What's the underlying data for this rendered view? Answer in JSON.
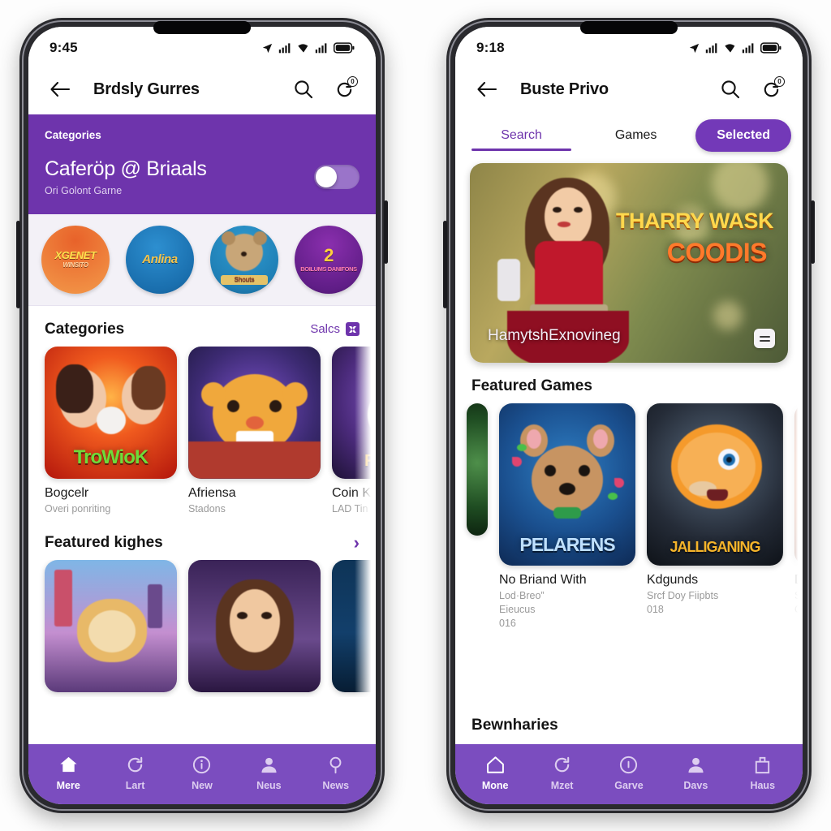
{
  "theme": {
    "brand_purple": "#6E34AC",
    "nav_purple": "#7B4DBF",
    "pill_purple": "#7339B8",
    "muted_text": "#9A9A9A"
  },
  "left_phone": {
    "status": {
      "time": "9:45"
    },
    "appbar": {
      "title": "Brdsly Gurres",
      "back_icon": "arrow-left-icon",
      "search_icon": "search-icon",
      "sync_icon": "refresh-icon",
      "sync_badge": "0"
    },
    "promo": {
      "kicker": "Categories",
      "title": "Caferöp @ Briaals",
      "subtitle": "Ori Golont Garne",
      "toggle_state": "off"
    },
    "circles": [
      {
        "label": "XGENET",
        "sub": "WINSITO",
        "bg": "#e8622a",
        "bg2": "#f39a4a",
        "text": "#ffe14d"
      },
      {
        "label": "Anlina",
        "sub": "",
        "bg": "#1a6fae",
        "bg2": "#2d8fd0",
        "text": "#f7c44a"
      },
      {
        "label": "Shouts",
        "sub": "",
        "bg": "#1f7fb5",
        "bg2": "#2f9ad0",
        "text": "#ffffff"
      },
      {
        "label": "2",
        "sub": "BOILUMS DANIFONS",
        "bg": "#5f1d86",
        "bg2": "#8a2fae",
        "text": "#ffcf3d"
      }
    ],
    "categories_section": {
      "title": "Categories",
      "action_label": "Salcs",
      "action_icon": "shuffle-icon"
    },
    "category_cards": [
      {
        "art_text": "TroWioK",
        "name": "Bogcelr",
        "sub": "Overi ponriting",
        "art_class": "art-trowiok"
      },
      {
        "art_text": "",
        "name": "Afriensa",
        "sub": "Stadons",
        "art_class": "art-afriensa"
      },
      {
        "art_text": "FAC VAW",
        "name": "Coin K",
        "sub": "LAD Tin",
        "art_class": "art-coink"
      }
    ],
    "featured_section": {
      "title": "Featured kighes",
      "action_icon": "chevron-right-icon"
    },
    "featured_cards": [
      {
        "art_class": "art-city",
        "name": "",
        "sub": ""
      },
      {
        "art_class": "art-girl",
        "name": "",
        "sub": ""
      },
      {
        "art_class": "art-apple",
        "name": "",
        "sub": ""
      }
    ],
    "bottom_nav": [
      {
        "label": "Mere",
        "icon": "home-icon",
        "active": true
      },
      {
        "label": "Lart",
        "icon": "refresh-icon",
        "active": false
      },
      {
        "label": "New",
        "icon": "info-icon",
        "active": false
      },
      {
        "label": "Neus",
        "icon": "person-icon",
        "active": false
      },
      {
        "label": "News",
        "icon": "pin-icon",
        "active": false
      }
    ]
  },
  "right_phone": {
    "status": {
      "time": "9:18"
    },
    "appbar": {
      "title": "Buste Privo",
      "back_icon": "arrow-left-icon",
      "search_icon": "search-icon",
      "sync_icon": "refresh-icon",
      "sync_badge": "0"
    },
    "tabs": [
      {
        "label": "Search",
        "state": "active"
      },
      {
        "label": "Games",
        "state": "inactive"
      },
      {
        "label": "Selected",
        "state": "pill"
      }
    ],
    "hero": {
      "logo_line1": "THARRY WASK",
      "logo_line2": "COODIS",
      "caption": "HamytshExnovineg",
      "menu_icon": "list-icon"
    },
    "featured_section": {
      "title": "Featured Games"
    },
    "featured_cards": [
      {
        "art_text": "",
        "art_class": "art-green",
        "name": "",
        "sub1": "",
        "sub2": "",
        "sub3": ""
      },
      {
        "art_text": "PELARENS",
        "art_class": "art-pelarens",
        "name": "No Briand With",
        "sub1": "Lod·Breo”",
        "sub2": "Eieucus",
        "sub3": "016"
      },
      {
        "art_text": "JALLIGANING",
        "art_class": "art-jall",
        "name": "Kdgunds",
        "sub1": "Srcf Doy Fiipbts",
        "sub2": "018",
        "sub3": ""
      },
      {
        "art_text": "",
        "art_class": "art-dos",
        "name": "Dos",
        "sub1": "Soni",
        "sub2": "CVD",
        "sub3": ""
      }
    ],
    "bottom_section_title": "Bewnharies",
    "bottom_nav": [
      {
        "label": "Mone",
        "icon": "home-icon",
        "active": true
      },
      {
        "label": "Mzet",
        "icon": "refresh-icon",
        "active": false
      },
      {
        "label": "Garve",
        "icon": "info-icon",
        "active": false
      },
      {
        "label": "Davs",
        "icon": "person-icon",
        "active": false
      },
      {
        "label": "Haus",
        "icon": "bag-icon",
        "active": false
      }
    ]
  }
}
